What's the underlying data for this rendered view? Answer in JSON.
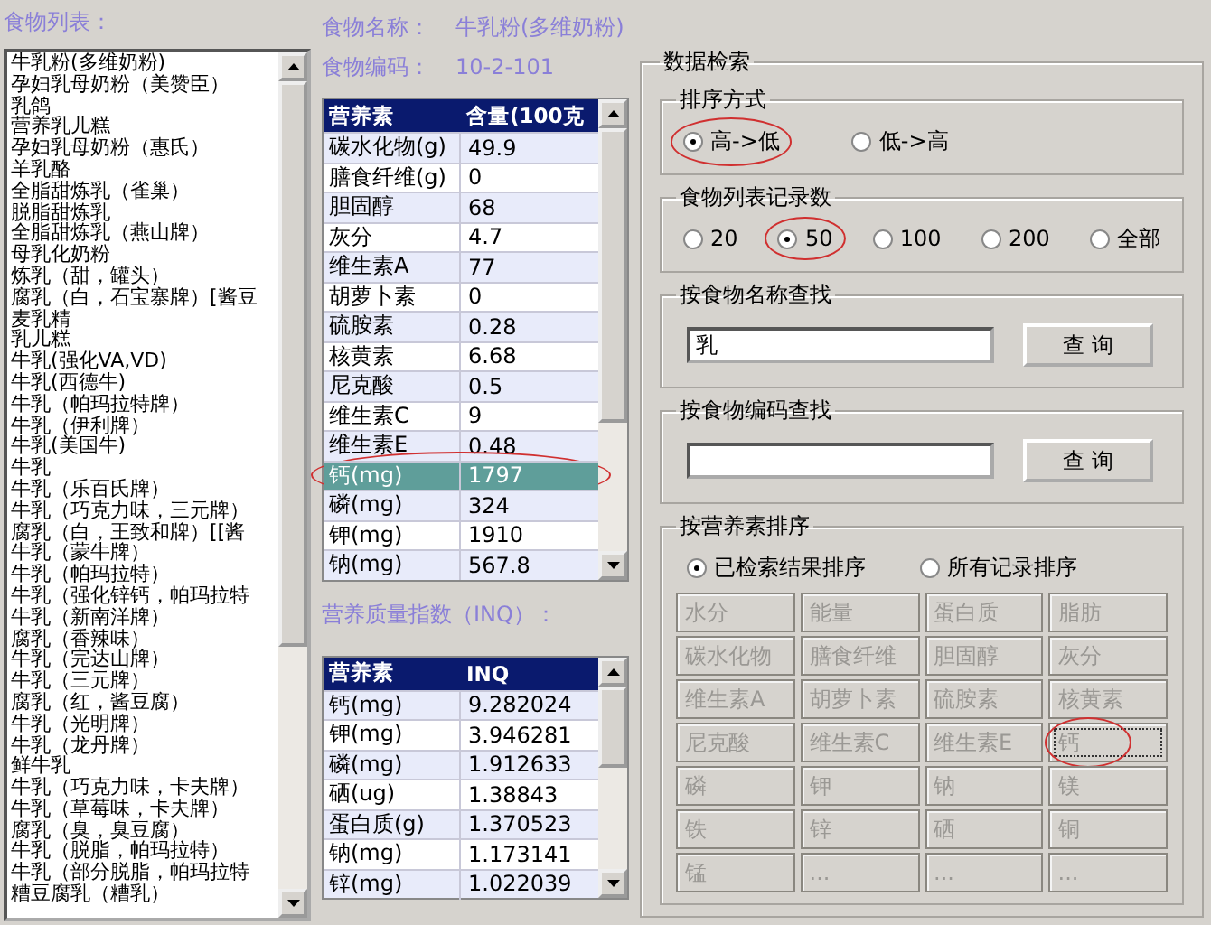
{
  "food_list": {
    "label": "食物列表：",
    "items": [
      {
        "name": "牛乳粉(多维奶粉)"
      },
      {
        "name": "孕妇乳母奶粉（美赞臣）"
      },
      {
        "name": "乳鸽"
      },
      {
        "name": "营养乳儿糕"
      },
      {
        "name": "孕妇乳母奶粉（惠氏）"
      },
      {
        "name": "羊乳酪"
      },
      {
        "name": "全脂甜炼乳（雀巢）"
      },
      {
        "name": "脱脂甜炼乳"
      },
      {
        "name": "全脂甜炼乳（燕山牌）"
      },
      {
        "name": "母乳化奶粉"
      },
      {
        "name": "炼乳（甜，罐头）"
      },
      {
        "name": "腐乳（白，石宝寨牌）[酱豆"
      },
      {
        "name": "麦乳精"
      },
      {
        "name": "乳儿糕"
      },
      {
        "name": "牛乳(强化VA,VD)"
      },
      {
        "name": "牛乳(西德牛)"
      },
      {
        "name": "牛乳（帕玛拉特牌）"
      },
      {
        "name": "牛乳（伊利牌）"
      },
      {
        "name": "牛乳(美国牛)"
      },
      {
        "name": "牛乳"
      },
      {
        "name": "牛乳（乐百氏牌）"
      },
      {
        "name": "牛乳（巧克力味，三元牌）"
      },
      {
        "name": "腐乳（白，王致和牌）[[酱"
      },
      {
        "name": "牛乳（蒙牛牌）"
      },
      {
        "name": "牛乳（帕玛拉特）"
      },
      {
        "name": "牛乳（强化锌钙，帕玛拉特"
      },
      {
        "name": "牛乳（新南洋牌）"
      },
      {
        "name": "腐乳（香辣味）"
      },
      {
        "name": "牛乳（完达山牌）"
      },
      {
        "name": "牛乳（三元牌）"
      },
      {
        "name": "腐乳（红，酱豆腐）"
      },
      {
        "name": "牛乳（光明牌）"
      },
      {
        "name": "牛乳（龙丹牌）"
      },
      {
        "name": "鲜牛乳"
      },
      {
        "name": "牛乳（巧克力味，卡夫牌）"
      },
      {
        "name": "牛乳（草莓味，卡夫牌）"
      },
      {
        "name": "腐乳（臭，臭豆腐）"
      },
      {
        "name": "牛乳（脱脂，帕玛拉特）"
      },
      {
        "name": "牛乳（部分脱脂，帕玛拉特"
      },
      {
        "name": "糟豆腐乳（糟乳）"
      }
    ]
  },
  "food_info": {
    "name_label": "食物名称：",
    "name_value": "牛乳粉(多维奶粉)",
    "code_label": "食物编码：",
    "code_value": "10-2-101"
  },
  "nutrient_table": {
    "columns": [
      "营养素",
      "含量(100克"
    ],
    "rows": [
      {
        "nutrient": "碳水化物(g)",
        "value": "49.9",
        "selected": false,
        "circled": false
      },
      {
        "nutrient": "膳食纤维(g)",
        "value": "0",
        "selected": false,
        "circled": false
      },
      {
        "nutrient": "胆固醇",
        "value": "68",
        "selected": false,
        "circled": false
      },
      {
        "nutrient": "灰分",
        "value": "4.7",
        "selected": false,
        "circled": false
      },
      {
        "nutrient": "维生素A",
        "value": "77",
        "selected": false,
        "circled": false
      },
      {
        "nutrient": "胡萝卜素",
        "value": "0",
        "selected": false,
        "circled": false
      },
      {
        "nutrient": "硫胺素",
        "value": "0.28",
        "selected": false,
        "circled": false
      },
      {
        "nutrient": "核黄素",
        "value": "6.68",
        "selected": false,
        "circled": false
      },
      {
        "nutrient": "尼克酸",
        "value": "0.5",
        "selected": false,
        "circled": false
      },
      {
        "nutrient": "维生素C",
        "value": "9",
        "selected": false,
        "circled": false
      },
      {
        "nutrient": "维生素E",
        "value": "0.48",
        "selected": false,
        "circled": false
      },
      {
        "nutrient": "钙(mg)",
        "value": "1797",
        "selected": true,
        "circled": true
      },
      {
        "nutrient": "磷(mg)",
        "value": "324",
        "selected": false,
        "circled": false
      },
      {
        "nutrient": "钾(mg)",
        "value": "1910",
        "selected": false,
        "circled": false
      },
      {
        "nutrient": "钠(mg)",
        "value": "567.8",
        "selected": false,
        "circled": false
      }
    ]
  },
  "inq_label": "营养质量指数（INQ）：",
  "inq_table": {
    "columns": [
      "营养素",
      "INQ"
    ],
    "rows": [
      {
        "nutrient": "钙(mg)",
        "value": "9.282024"
      },
      {
        "nutrient": "钾(mg)",
        "value": "3.946281"
      },
      {
        "nutrient": "磷(mg)",
        "value": "1.912633"
      },
      {
        "nutrient": "硒(ug)",
        "value": "1.38843"
      },
      {
        "nutrient": "蛋白质(g)",
        "value": "1.370523"
      },
      {
        "nutrient": "钠(mg)",
        "value": "1.173141"
      },
      {
        "nutrient": "锌(mg)",
        "value": "1.022039"
      }
    ]
  },
  "search": {
    "title": "数据检索",
    "sort_order": {
      "title": "排序方式",
      "options": [
        {
          "label": "高->低",
          "selected": true,
          "circled": true
        },
        {
          "label": "低->高",
          "selected": false,
          "circled": false
        }
      ]
    },
    "record_count": {
      "title": "食物列表记录数",
      "options": [
        {
          "label": "20",
          "selected": false,
          "circled": false
        },
        {
          "label": "50",
          "selected": true,
          "circled": true
        },
        {
          "label": "100",
          "selected": false,
          "circled": false
        },
        {
          "label": "200",
          "selected": false,
          "circled": false
        },
        {
          "label": "全部",
          "selected": false,
          "circled": false
        }
      ]
    },
    "by_name": {
      "title": "按食物名称查找",
      "value": "乳",
      "button": "查 询"
    },
    "by_code": {
      "title": "按食物编码查找",
      "button": "查 询"
    },
    "by_nutrient": {
      "title": "按营养素排序",
      "scope": [
        {
          "label": "已检索结果排序",
          "selected": true
        },
        {
          "label": "所有记录排序",
          "selected": false
        }
      ],
      "buttons": [
        {
          "label": "水分",
          "focused": false,
          "circled": false
        },
        {
          "label": "能量",
          "focused": false,
          "circled": false
        },
        {
          "label": "蛋白质",
          "focused": false,
          "circled": false
        },
        {
          "label": "脂肪",
          "focused": false,
          "circled": false
        },
        {
          "label": "碳水化物",
          "focused": false,
          "circled": false
        },
        {
          "label": "膳食纤维",
          "focused": false,
          "circled": false
        },
        {
          "label": "胆固醇",
          "focused": false,
          "circled": false
        },
        {
          "label": "灰分",
          "focused": false,
          "circled": false
        },
        {
          "label": "维生素A",
          "focused": false,
          "circled": false
        },
        {
          "label": "胡萝卜素",
          "focused": false,
          "circled": false
        },
        {
          "label": "硫胺素",
          "focused": false,
          "circled": false
        },
        {
          "label": "核黄素",
          "focused": false,
          "circled": false
        },
        {
          "label": "尼克酸",
          "focused": false,
          "circled": false
        },
        {
          "label": "维生素C",
          "focused": false,
          "circled": false
        },
        {
          "label": "维生素E",
          "focused": false,
          "circled": false
        },
        {
          "label": "钙",
          "focused": true,
          "circled": true
        },
        {
          "label": "磷",
          "focused": false,
          "circled": false
        },
        {
          "label": "钾",
          "focused": false,
          "circled": false
        },
        {
          "label": "钠",
          "focused": false,
          "circled": false
        },
        {
          "label": "镁",
          "focused": false,
          "circled": false
        },
        {
          "label": "铁",
          "focused": false,
          "circled": false
        },
        {
          "label": "锌",
          "focused": false,
          "circled": false
        },
        {
          "label": "硒",
          "focused": false,
          "circled": false
        },
        {
          "label": "铜",
          "focused": false,
          "circled": false
        },
        {
          "label": "锰",
          "focused": false,
          "circled": false
        },
        {
          "label": "...",
          "focused": false,
          "circled": false
        },
        {
          "label": "...",
          "focused": false,
          "circled": false
        },
        {
          "label": "...",
          "focused": false,
          "circled": false
        }
      ]
    }
  }
}
